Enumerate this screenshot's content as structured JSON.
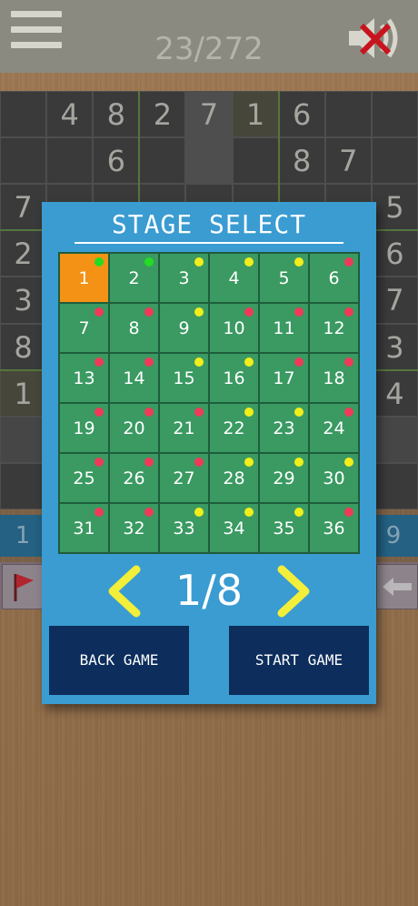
{
  "header": {
    "level_counter": "23/272",
    "menu_icon": "hamburger-menu-icon",
    "sound_icon": "speaker-muted-icon"
  },
  "board": {
    "rows": [
      [
        "",
        "4",
        "8",
        "2",
        "7",
        "1",
        "6",
        "",
        ""
      ],
      [
        "",
        "",
        "6",
        "",
        "",
        "",
        "8",
        "7",
        ""
      ],
      [
        "7",
        "",
        "",
        "",
        "",
        "",
        "",
        "",
        "5"
      ],
      [
        "2",
        "",
        "",
        "",
        "",
        "",
        "",
        "",
        "6"
      ],
      [
        "3",
        "",
        "",
        "",
        "",
        "",
        "",
        "",
        "7"
      ],
      [
        "8",
        "",
        "",
        "",
        "",
        "",
        "",
        "",
        "3"
      ],
      [
        "1",
        "",
        "",
        "",
        "",
        "",
        "",
        "",
        "4"
      ],
      [
        "",
        "",
        "",
        "",
        "",
        "",
        "",
        "",
        ""
      ],
      [
        "",
        "",
        "",
        "",
        "",
        "",
        "",
        "",
        ""
      ]
    ]
  },
  "number_bar": {
    "left": "1",
    "right": "9"
  },
  "toolbar": {
    "flag_icon": "red-flag-icon",
    "back_icon": "back-arrow-icon"
  },
  "dialog": {
    "title": "STAGE SELECT",
    "stages": [
      {
        "n": "1",
        "status": "green",
        "current": true
      },
      {
        "n": "2",
        "status": "green"
      },
      {
        "n": "3",
        "status": "yellow"
      },
      {
        "n": "4",
        "status": "yellow"
      },
      {
        "n": "5",
        "status": "yellow"
      },
      {
        "n": "6",
        "status": "red"
      },
      {
        "n": "7",
        "status": "red"
      },
      {
        "n": "8",
        "status": "red"
      },
      {
        "n": "9",
        "status": "yellow"
      },
      {
        "n": "10",
        "status": "red"
      },
      {
        "n": "11",
        "status": "red"
      },
      {
        "n": "12",
        "status": "red"
      },
      {
        "n": "13",
        "status": "red"
      },
      {
        "n": "14",
        "status": "red"
      },
      {
        "n": "15",
        "status": "yellow"
      },
      {
        "n": "16",
        "status": "yellow"
      },
      {
        "n": "17",
        "status": "red"
      },
      {
        "n": "18",
        "status": "red"
      },
      {
        "n": "19",
        "status": "red"
      },
      {
        "n": "20",
        "status": "red"
      },
      {
        "n": "21",
        "status": "red"
      },
      {
        "n": "22",
        "status": "yellow"
      },
      {
        "n": "23",
        "status": "yellow"
      },
      {
        "n": "24",
        "status": "red"
      },
      {
        "n": "25",
        "status": "red"
      },
      {
        "n": "26",
        "status": "red"
      },
      {
        "n": "27",
        "status": "red"
      },
      {
        "n": "28",
        "status": "yellow"
      },
      {
        "n": "29",
        "status": "yellow"
      },
      {
        "n": "30",
        "status": "yellow"
      },
      {
        "n": "31",
        "status": "red"
      },
      {
        "n": "32",
        "status": "red"
      },
      {
        "n": "33",
        "status": "yellow"
      },
      {
        "n": "34",
        "status": "yellow"
      },
      {
        "n": "35",
        "status": "yellow"
      },
      {
        "n": "36",
        "status": "red"
      }
    ],
    "page": "1/8",
    "prev_icon": "chevron-left-icon",
    "next_icon": "chevron-right-icon",
    "back_label": "BACK GAME",
    "start_label": "START GAME"
  },
  "colors": {
    "status_green": "#22dd22",
    "status_yellow": "#f2ee1a",
    "status_red": "#ef3a5a",
    "current_stage": "#f39214",
    "dialog_bg": "#3a9cd1",
    "button_bg": "#0d2e5c",
    "chevron": "#f2ee3a"
  }
}
